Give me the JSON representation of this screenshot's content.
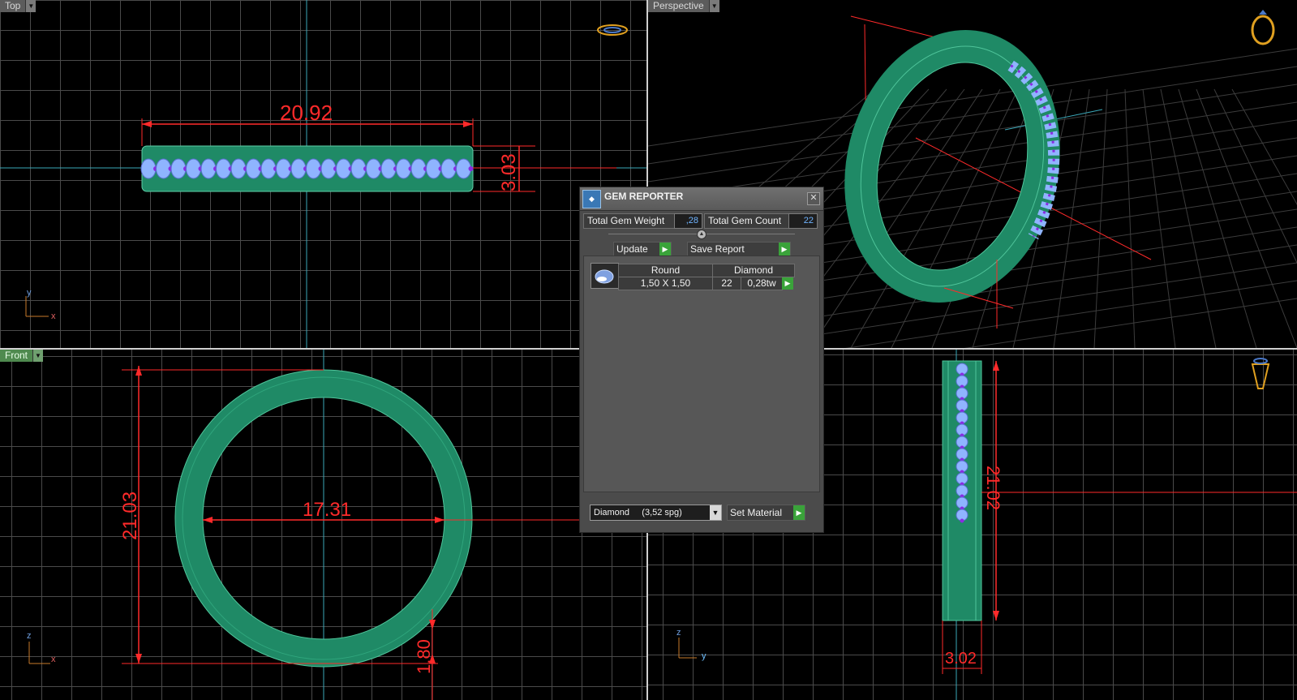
{
  "viewports": {
    "top": {
      "label": "Top",
      "axis_v": "y",
      "axis_h": "x",
      "dim_width": "20.92",
      "dim_height": "3.03"
    },
    "perspective": {
      "label": "Perspective"
    },
    "front": {
      "label": "Front",
      "axis_v": "z",
      "axis_h": "x",
      "dim_outer": "21.03",
      "dim_inner": "17.31",
      "dim_thickness": "1.80"
    },
    "side": {
      "axis_v": "z",
      "axis_h": "y",
      "dim_height": "21.02",
      "dim_width": "3.02"
    }
  },
  "gem_reporter": {
    "title": "GEM REPORTER",
    "total_weight_label": "Total Gem Weight",
    "total_weight_value": ",28",
    "total_count_label": "Total Gem Count",
    "total_count_value": "22",
    "update_label": "Update",
    "save_report_label": "Save Report",
    "table_headers": {
      "shape": "Round",
      "material": "Diamond"
    },
    "rows": [
      {
        "size": "1,50 X 1,50",
        "count": "22",
        "weight": "0,28tw"
      }
    ],
    "material_select": "Diamond     (3,52 spg)",
    "set_material_label": "Set Material"
  },
  "colors": {
    "band": "#1f8a66",
    "gem": "#8fb4ff",
    "prong": "#8a2be2",
    "dimension": "#ff2a2a"
  }
}
